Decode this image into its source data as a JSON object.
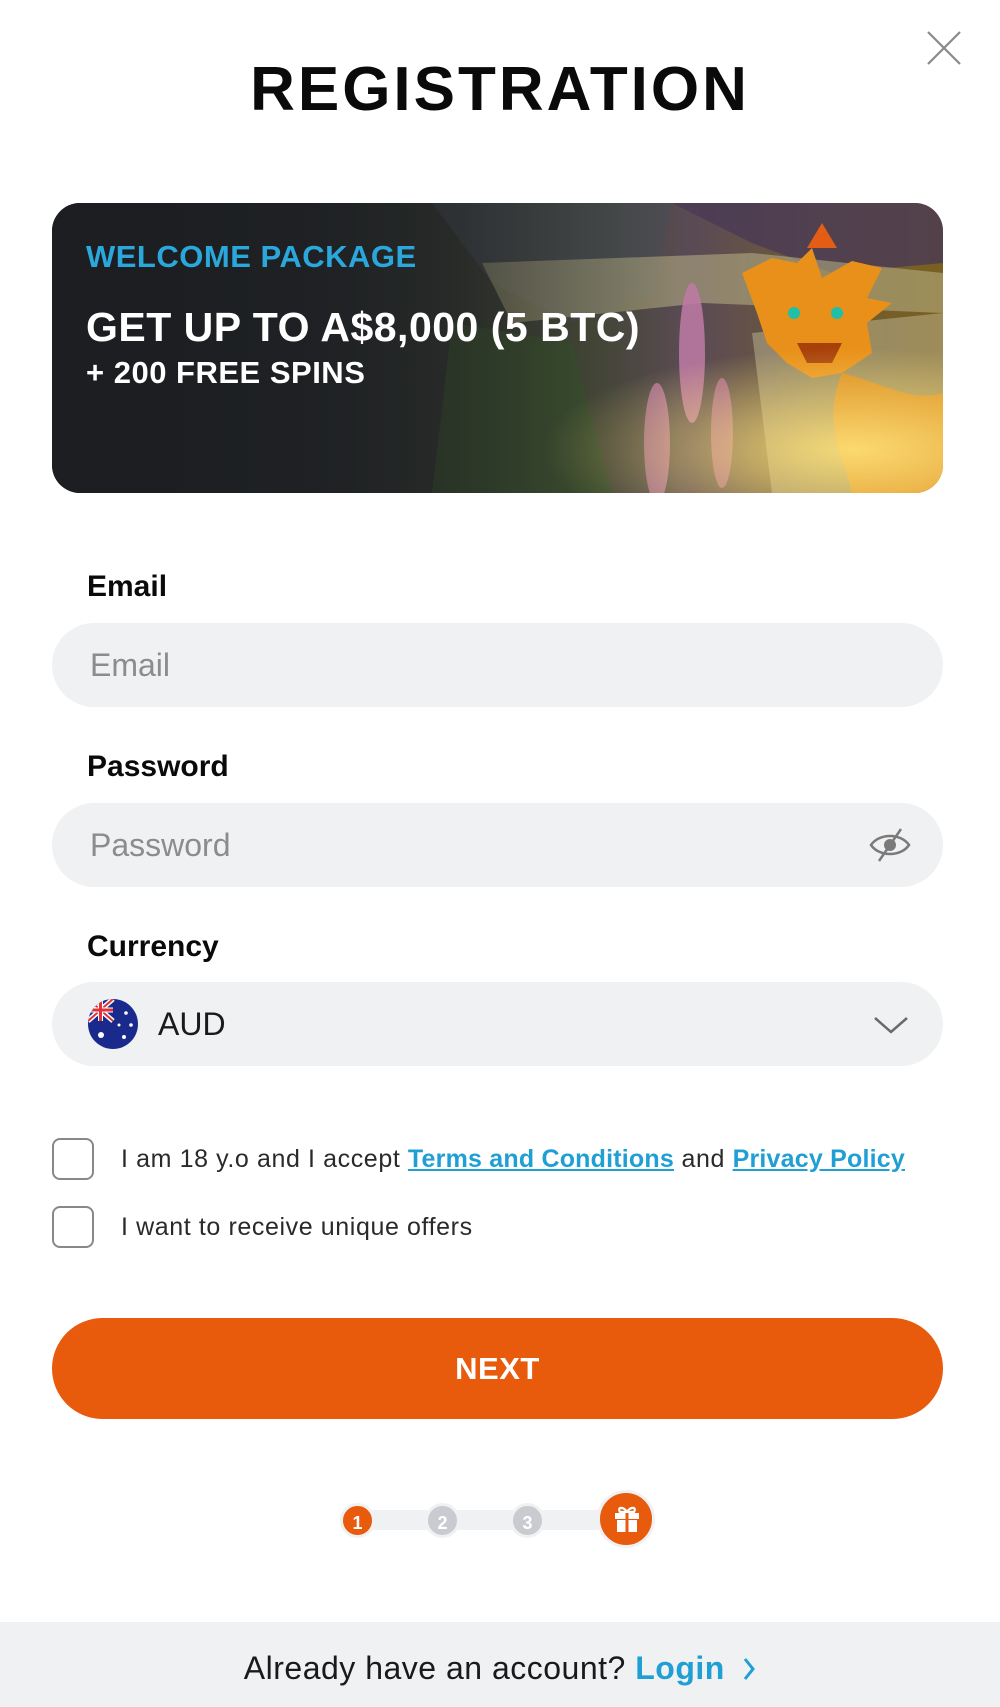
{
  "header": {
    "title": "REGISTRATION",
    "close_icon": "close-icon"
  },
  "banner": {
    "kicker": "WELCOME PACKAGE",
    "headline": "GET UP TO A$8,000 (5 BTC)",
    "subline": "+ 200 FREE SPINS",
    "accent_color": "#2aa8dc"
  },
  "form": {
    "email": {
      "label": "Email",
      "placeholder": "Email",
      "value": ""
    },
    "password": {
      "label": "Password",
      "placeholder": "Password",
      "value": "",
      "toggle_icon": "eye-slash-icon"
    },
    "currency": {
      "label": "Currency",
      "selected": "AUD",
      "flag_icon": "australia-flag-icon",
      "chevron_icon": "chevron-down-icon"
    }
  },
  "consents": {
    "age_terms": {
      "prefix": "I am 18 y.o and I accept ",
      "terms_link": "Terms and Conditions",
      "middle": " and ",
      "privacy_link": "Privacy Policy",
      "checked": false
    },
    "offers": {
      "label": "I want to receive unique offers",
      "checked": false
    }
  },
  "actions": {
    "next_label": "NEXT",
    "primary_color": "#e85a0c"
  },
  "stepper": {
    "steps": [
      "1",
      "2",
      "3"
    ],
    "current_step": 1,
    "final_icon": "gift-icon"
  },
  "footer": {
    "prompt": "Already have an account? ",
    "login_label": "Login",
    "login_icon": "chevron-right-icon",
    "link_color": "#1f9fd3"
  }
}
